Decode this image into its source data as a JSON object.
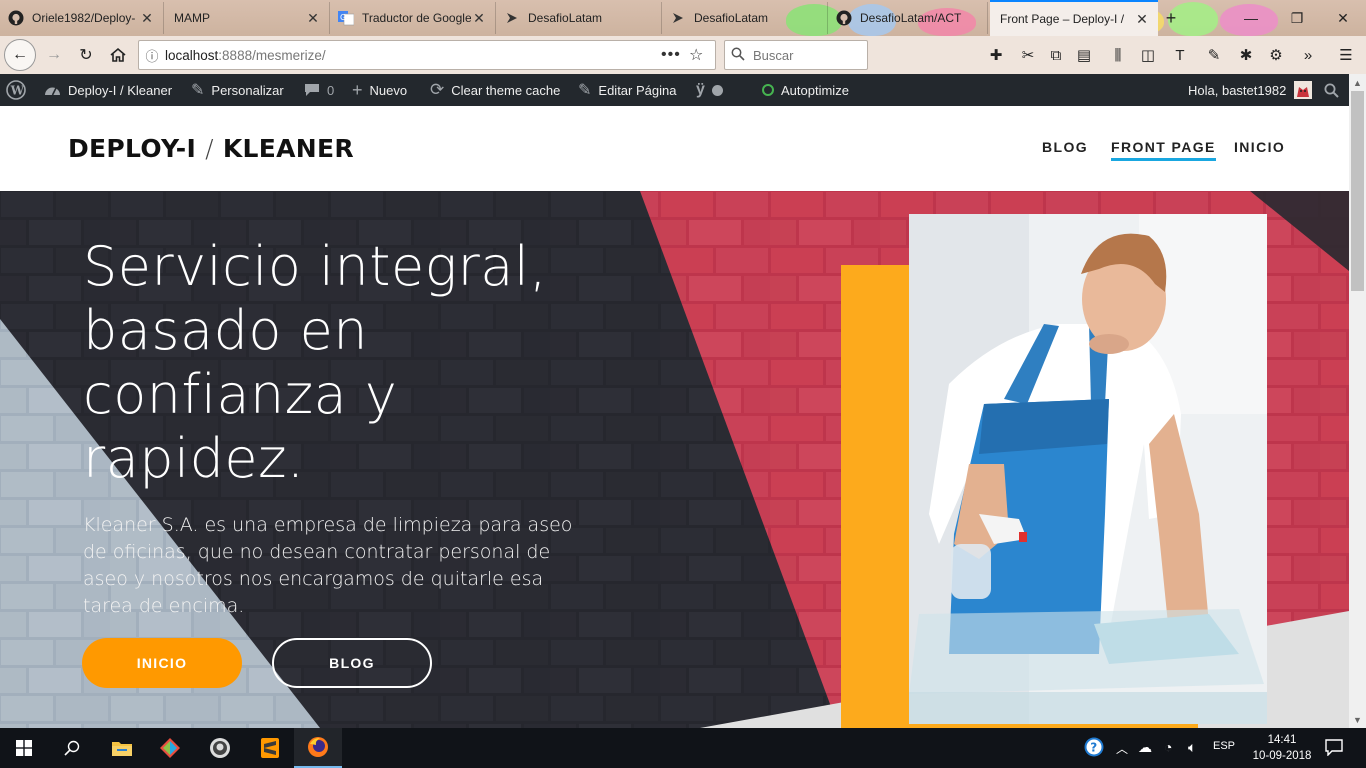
{
  "browser": {
    "tabs": [
      {
        "label": "Oriele1982/Deploy-",
        "icon": "github-icon",
        "active": false
      },
      {
        "label": "MAMP",
        "icon": "",
        "active": false
      },
      {
        "label": "Traductor de Google",
        "icon": "google-translate-icon",
        "active": false
      },
      {
        "label": "DesafioLatam",
        "icon": "desafiolatam-icon",
        "active": false
      },
      {
        "label": "DesafioLatam",
        "icon": "desafiolatam-icon",
        "active": false
      },
      {
        "label": "DesafioLatam/ACT",
        "icon": "github-icon",
        "active": false
      },
      {
        "label": "Front Page – Deploy-I /",
        "icon": "",
        "active": true
      }
    ],
    "url_host": "localhost",
    "url_rest": ":8888/mesmerize/",
    "search_placeholder": "Buscar",
    "window_controls": [
      "minimize",
      "restore",
      "close"
    ]
  },
  "admin_bar": {
    "site_name": "Deploy-I / Kleaner",
    "customize": "Personalizar",
    "comments_count": "0",
    "new": "Nuevo",
    "clear_cache": "Clear theme cache",
    "edit_page": "Editar Página",
    "autoptimize": "Autoptimize",
    "greeting": "Hola, bastet1982"
  },
  "site": {
    "title_a": "DEPLOY-I",
    "title_sep": "/",
    "title_b": "KLEANER",
    "menu": [
      {
        "label": "BLOG",
        "current": false
      },
      {
        "label": "FRONT PAGE",
        "current": true
      },
      {
        "label": "INICIO",
        "current": false
      }
    ]
  },
  "hero": {
    "title_lines": [
      "Servicio integral,",
      "basado en",
      "confianza y",
      "rapidez."
    ],
    "description": "Kleaner  S.A. es una empresa de limpieza para aseo de oficinas, que no desean contratar personal de aseo y nosotros nos encargamos de quitarle esa tarea de encima.",
    "button_primary": "INICIO",
    "button_secondary": "BLOG"
  },
  "taskbar": {
    "apps": [
      "file-explorer-icon",
      "gitkraken-icon",
      "github-desktop-icon",
      "sublime-text-icon",
      "firefox-icon"
    ],
    "language": "ESP",
    "time": "14:41",
    "date": "10-09-2018"
  },
  "colors": {
    "admin_bar": "#23282d",
    "accent_orange": "#ff9900",
    "yellow_block": "#fdaa1c",
    "menu_underline": "#19a7e0",
    "brand_pink": "#e8485f"
  }
}
